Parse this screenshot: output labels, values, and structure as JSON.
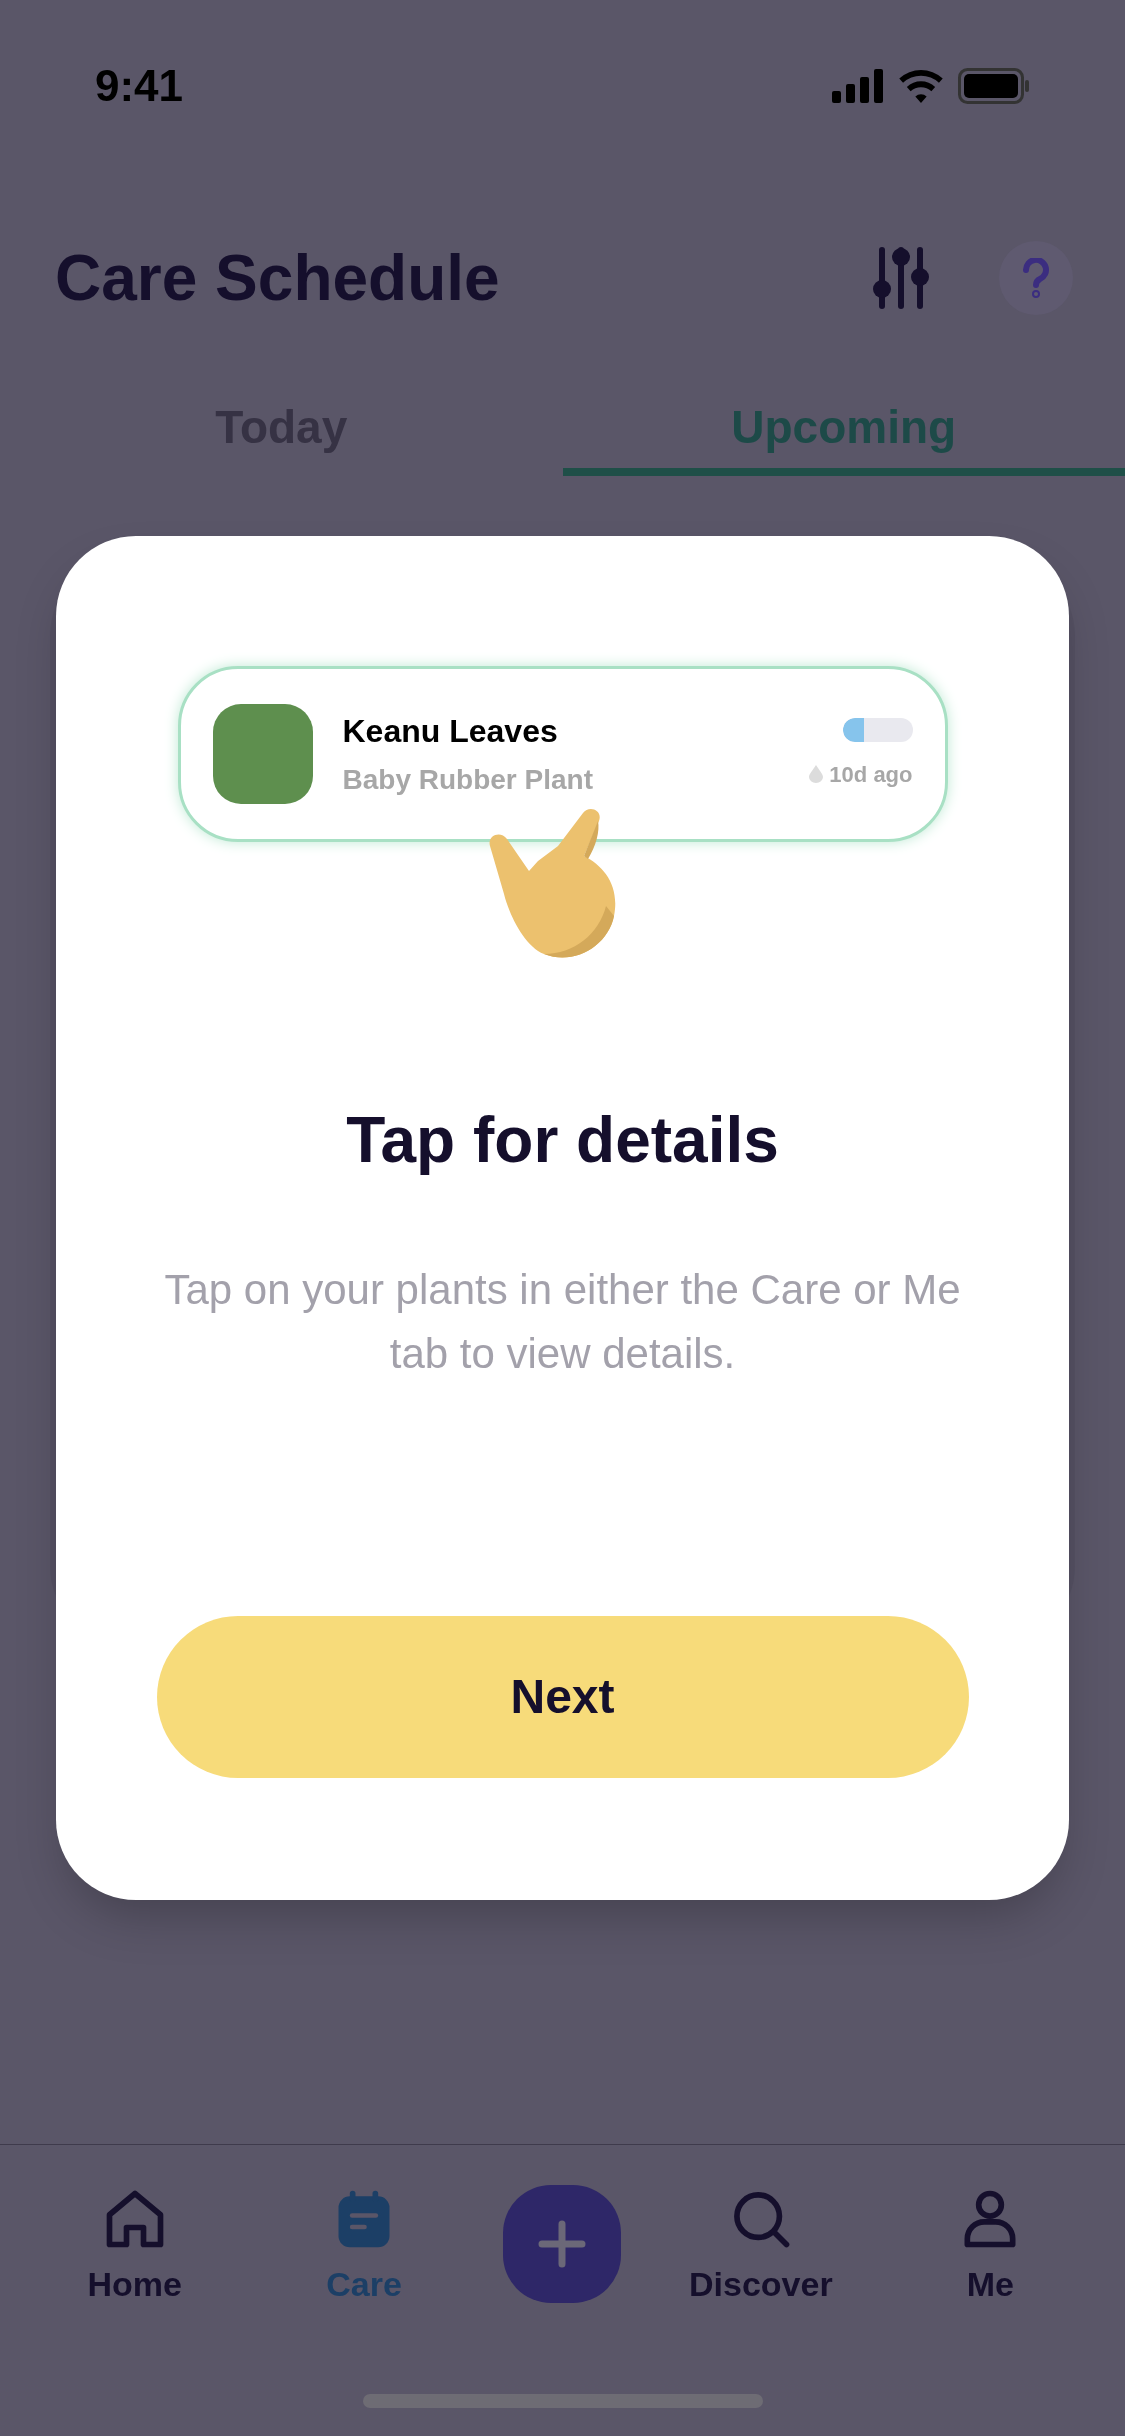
{
  "status_bar": {
    "time": "9:41"
  },
  "header": {
    "title": "Care Schedule"
  },
  "tabs": [
    {
      "label": "Today",
      "selected": false
    },
    {
      "label": "Upcoming",
      "selected": true
    }
  ],
  "dialog": {
    "plant_card": {
      "name": "Keanu Leaves",
      "species": "Baby Rubber Plant",
      "level": 0.3,
      "last_watered": "10d ago"
    },
    "title": "Tap for details",
    "description": "Tap on your plants in either the Care or Me tab to view details.",
    "button": "Next"
  },
  "nav": [
    {
      "kind": "home",
      "label": "Home",
      "selected": false
    },
    {
      "kind": "care",
      "label": "Care",
      "selected": true
    },
    {
      "kind": "add",
      "selected": false
    },
    {
      "kind": "discover",
      "label": "Discover",
      "selected": false
    },
    {
      "kind": "me",
      "label": "Me",
      "selected": false
    }
  ]
}
